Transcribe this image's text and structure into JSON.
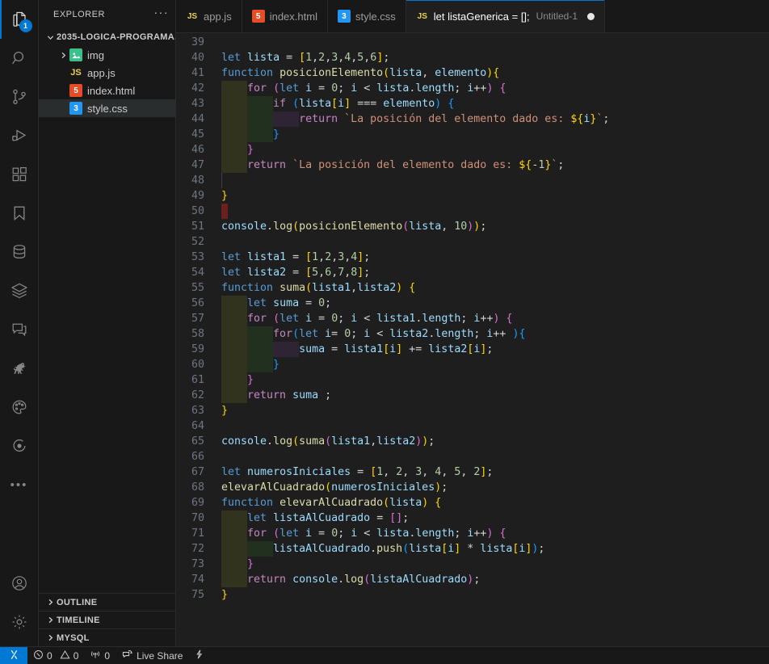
{
  "activitybar": {
    "items": [
      {
        "name": "explorer",
        "icon": "files-icon",
        "active": true,
        "badge": "1"
      },
      {
        "name": "search",
        "icon": "search-icon",
        "active": false
      },
      {
        "name": "source-control",
        "icon": "source-control-icon",
        "active": false
      },
      {
        "name": "run-and-debug",
        "icon": "run-debug-icon",
        "active": false
      },
      {
        "name": "extensions",
        "icon": "extensions-icon",
        "active": false
      },
      {
        "name": "bookmarks",
        "icon": "bookmark-icon",
        "active": false
      },
      {
        "name": "database",
        "icon": "database-icon",
        "active": false
      },
      {
        "name": "layers",
        "icon": "layers-icon",
        "active": false
      },
      {
        "name": "comments",
        "icon": "comment-icon",
        "active": false
      },
      {
        "name": "dinosaur",
        "icon": "dinosaur-icon",
        "active": false
      },
      {
        "name": "theme-palette",
        "icon": "palette-icon",
        "active": false
      },
      {
        "name": "target",
        "icon": "target-icon",
        "active": false
      },
      {
        "name": "more-views",
        "icon": "ellipsis-icon",
        "active": false
      }
    ],
    "bottom": [
      {
        "name": "accounts",
        "icon": "account-icon"
      },
      {
        "name": "manage-settings",
        "icon": "gear-icon"
      }
    ]
  },
  "sidebar": {
    "title": "EXPLORER",
    "more_label": "···",
    "root": {
      "label": "2035-LOGICA-PROGRAMA...",
      "expanded": true,
      "twisty": "⌄"
    },
    "files": [
      {
        "label": "img",
        "type": "folder",
        "icon": "image-folder-icon",
        "icon_text": "▣",
        "twisty": "›",
        "selected": false,
        "indent": 1
      },
      {
        "label": "app.js",
        "type": "file",
        "icon": "js-file-icon",
        "icon_text": "JS",
        "twisty": "",
        "selected": false,
        "indent": 1
      },
      {
        "label": "index.html",
        "type": "file",
        "icon": "html-file-icon",
        "icon_text": "5",
        "twisty": "",
        "selected": false,
        "indent": 1
      },
      {
        "label": "style.css",
        "type": "file",
        "icon": "css-file-icon",
        "icon_text": "3",
        "twisty": "",
        "selected": true,
        "indent": 1
      }
    ],
    "sections": [
      {
        "label": "OUTLINE",
        "expanded": false,
        "twisty": "›"
      },
      {
        "label": "TIMELINE",
        "expanded": false,
        "twisty": "›"
      },
      {
        "label": "MYSQL",
        "expanded": false,
        "twisty": "›"
      }
    ]
  },
  "tabs": [
    {
      "label": "app.js",
      "icon": "js-file-icon",
      "icon_text": "JS",
      "icon_kind": "js",
      "description": "",
      "active": false,
      "dirty": false
    },
    {
      "label": "index.html",
      "icon": "html-file-icon",
      "icon_text": "5",
      "icon_kind": "html",
      "description": "",
      "active": false,
      "dirty": false
    },
    {
      "label": "style.css",
      "icon": "css-file-icon",
      "icon_text": "3",
      "icon_kind": "css",
      "description": "",
      "active": false,
      "dirty": false
    },
    {
      "label": "let listaGenerica = [];",
      "icon": "js-file-icon",
      "icon_text": "JS",
      "icon_kind": "js",
      "description": "Untitled-1",
      "active": true,
      "dirty": true
    }
  ],
  "editor": {
    "first_line": 39,
    "last_line": 75,
    "language": "javascript",
    "lines": [
      {
        "n": 39,
        "text": ""
      },
      {
        "n": 40,
        "text": "let lista = [1,2,3,4,5,6];"
      },
      {
        "n": 41,
        "text": "function posicionElemento(lista, elemento){"
      },
      {
        "n": 42,
        "text": "    for (let i = 0; i < lista.length; i++) {"
      },
      {
        "n": 43,
        "text": "        if (lista[i] === elemento) {"
      },
      {
        "n": 44,
        "text": "            return `La posición del elemento dado es: ${i}`;"
      },
      {
        "n": 45,
        "text": "        }"
      },
      {
        "n": 46,
        "text": "    }"
      },
      {
        "n": 47,
        "text": "    return `La posición del elemento dado es: ${-1}`;"
      },
      {
        "n": 48,
        "text": ""
      },
      {
        "n": 49,
        "text": "}"
      },
      {
        "n": 50,
        "text": ""
      },
      {
        "n": 51,
        "text": "console.log(posicionElemento(lista, 10));"
      },
      {
        "n": 52,
        "text": ""
      },
      {
        "n": 53,
        "text": "let lista1 = [1,2,3,4];"
      },
      {
        "n": 54,
        "text": "let lista2 = [5,6,7,8];"
      },
      {
        "n": 55,
        "text": "function suma(lista1,lista2) {"
      },
      {
        "n": 56,
        "text": "    let suma = 0;"
      },
      {
        "n": 57,
        "text": "    for (let i = 0; i < lista1.length; i++) {"
      },
      {
        "n": 58,
        "text": "        for(let i= 0; i < lista2.length; i++ ){"
      },
      {
        "n": 59,
        "text": "            suma = lista1[i] += lista2[i];"
      },
      {
        "n": 60,
        "text": "        }"
      },
      {
        "n": 61,
        "text": "    }"
      },
      {
        "n": 62,
        "text": "    return suma ;"
      },
      {
        "n": 63,
        "text": "}"
      },
      {
        "n": 64,
        "text": ""
      },
      {
        "n": 65,
        "text": "console.log(suma(lista1,lista2));"
      },
      {
        "n": 66,
        "text": ""
      },
      {
        "n": 67,
        "text": "let numerosIniciales = [1, 2, 3, 4, 5, 2];"
      },
      {
        "n": 68,
        "text": "elevarAlCuadrado(numerosIniciales);"
      },
      {
        "n": 69,
        "text": "function elevarAlCuadrado(lista) {"
      },
      {
        "n": 70,
        "text": "    let listaAlCuadrado = [];"
      },
      {
        "n": 71,
        "text": "    for (let i = 0; i < lista.length; i++) {"
      },
      {
        "n": 72,
        "text": "        listaAlCuadrado.push(lista[i] * lista[i]);"
      },
      {
        "n": 73,
        "text": "    }"
      },
      {
        "n": 74,
        "text": "    return console.log(listaAlCuadrado);"
      },
      {
        "n": 75,
        "text": "}"
      }
    ]
  },
  "statusbar": {
    "remote_icon": "remote-window-icon",
    "errors": "0",
    "warnings": "0",
    "ports": "0",
    "live_share": "Live Share",
    "lightning_icon": "lightning-icon"
  },
  "colors": {
    "accent": "#0078d4",
    "editor_bg": "#1e1e1e",
    "chrome_bg": "#181818",
    "selection_bg": "#2a2d2e",
    "keyword": "#569cd6",
    "control": "#c586c0",
    "variable": "#9cdcfe",
    "function": "#dcdcaa",
    "number": "#b5cea8",
    "string": "#ce9178",
    "bracket1": "#ffd700",
    "bracket2": "#da70d6",
    "bracket3": "#179fff"
  }
}
